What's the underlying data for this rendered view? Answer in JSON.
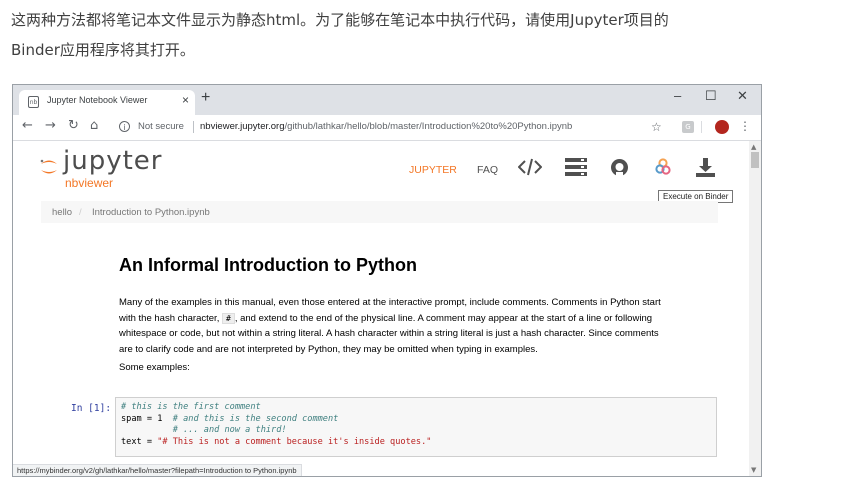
{
  "article": {
    "line1": "这两种方法都将笔记本文件显示为静态html。为了能够在笔记本中执行代码，请使用Jupyter项目的",
    "line2": "Binder应用程序将其打开。"
  },
  "browser": {
    "tab_title": "Jupyter Notebook Viewer",
    "tab_close": "×",
    "new_tab": "+",
    "window_controls": [
      "–",
      "☐",
      "✕"
    ],
    "security_label": "Not secure",
    "url_domain": "nbviewer.jupyter.org",
    "url_path": "/github/lathkar/hello/blob/master/Introduction%20to%20Python.ipynb",
    "status_url": "https://mybinder.org/v2/gh/lathkar/hello/master?filepath=Introduction to Python.ipynb"
  },
  "nbviewer": {
    "logo_text": "jupyter",
    "logo_sub": "nbviewer",
    "nav": {
      "jupyter": "JUPYTER",
      "faq": "FAQ"
    },
    "tooltip": "Execute on Binder",
    "breadcrumb": {
      "root": "hello",
      "separator": "/",
      "file": "Introduction to Python.ipynb"
    },
    "brand_color": "#F37726"
  },
  "notebook": {
    "title": "An Informal Introduction to Python",
    "para": {
      "l1": "Many of the examples in this manual, even those entered at the interactive prompt, include comments. Comments in Python start",
      "l2a": "with the hash character,",
      "hash": "#",
      "l2b": ", and extend to the end of the physical line. A comment may appear at the start of a line or following",
      "l3": "whitespace or code, but not within a string literal. A hash character within a string literal is just a hash character. Since comments",
      "l4": "are to clarify code and are not interpreted by Python, they may be omitted when typing in examples."
    },
    "examples_label": "Some examples:",
    "cell": {
      "prompt": "In [1]:",
      "c1": "# this is the first comment",
      "c2_code": "spam = 1  ",
      "c2_comment": "# and this is the second comment",
      "c3": "          # ... and now a third!",
      "c4_code": "text = ",
      "c4_string": "\"# This is not a comment because it's inside quotes.\""
    }
  }
}
